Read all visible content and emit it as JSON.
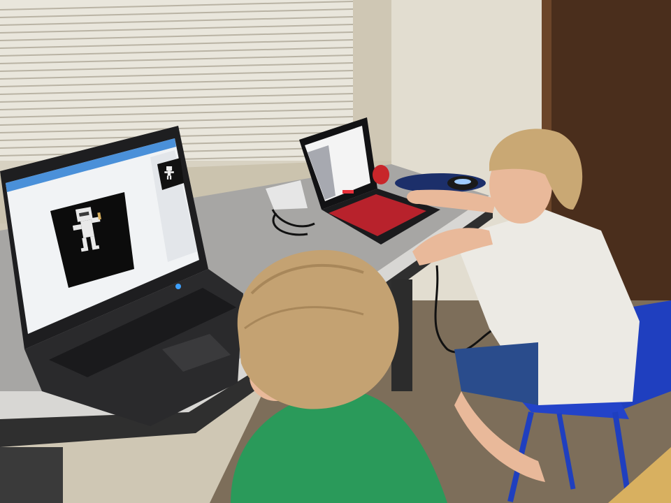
{
  "scene": {
    "description_tags": [
      "room",
      "window-blinds",
      "desk",
      "laptop-left",
      "laptop-right",
      "child-green-shirt",
      "child-white-shirt",
      "blue-chair",
      "mouse",
      "cables",
      "carpet",
      "door"
    ],
    "colors": {
      "wall": "#d9d2c0",
      "blinds": "#e8e4d8",
      "desk_top": "#a9a8a6",
      "desk_edge": "#3a3a3a",
      "laptop_left_body": "#2b2b2d",
      "laptop_left_screen": "#f2f4f6",
      "laptop_left_screen_bar": "#4a90d9",
      "sprite_bg": "#0d0d0d",
      "sprite": "#e9e9e9",
      "laptop_right_body": "#121214",
      "laptop_right_keys": "#d0202a",
      "green_shirt": "#2a9a5a",
      "white_shirt": "#eceae4",
      "hair": "#c9a874",
      "skin": "#e9b99a",
      "chair_blue": "#1f3fbf",
      "shorts": "#2a4c8c",
      "carpet": "#7d6e5a",
      "door": "#5a3a24"
    }
  }
}
